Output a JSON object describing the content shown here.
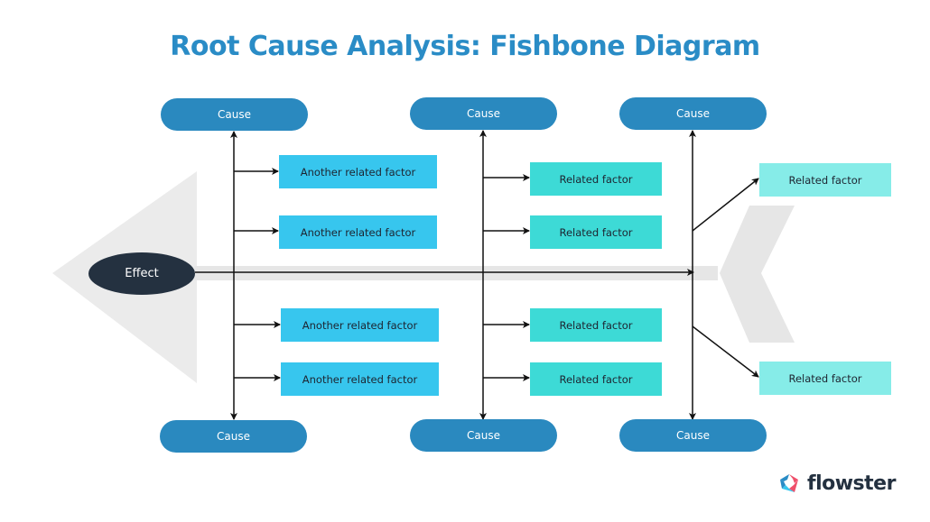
{
  "title": "Root Cause Analysis: Fishbone Diagram",
  "effect": {
    "label": "Effect"
  },
  "causes": {
    "top": [
      "Cause",
      "Cause",
      "Cause"
    ],
    "bottom": [
      "Cause",
      "Cause",
      "Cause"
    ]
  },
  "factors": {
    "left_top": [
      "Another related factor",
      "Another related factor"
    ],
    "left_bottom": [
      "Another related factor",
      "Another related factor"
    ],
    "middle_top": [
      "Related factor",
      "Related factor"
    ],
    "middle_bottom": [
      "Related factor",
      "Related factor"
    ],
    "right_top": [
      "Related factor"
    ],
    "right_bottom": [
      "Related factor"
    ]
  },
  "colors": {
    "title": "#2a8cc6",
    "cause": "#2a89bf",
    "effect": "#243140",
    "factor_blue": "#37c6ee",
    "factor_teal": "#3ddad6",
    "factor_light": "#86ece8",
    "fish_shape": "#ebebeb"
  },
  "logo": {
    "name": "flowster"
  }
}
